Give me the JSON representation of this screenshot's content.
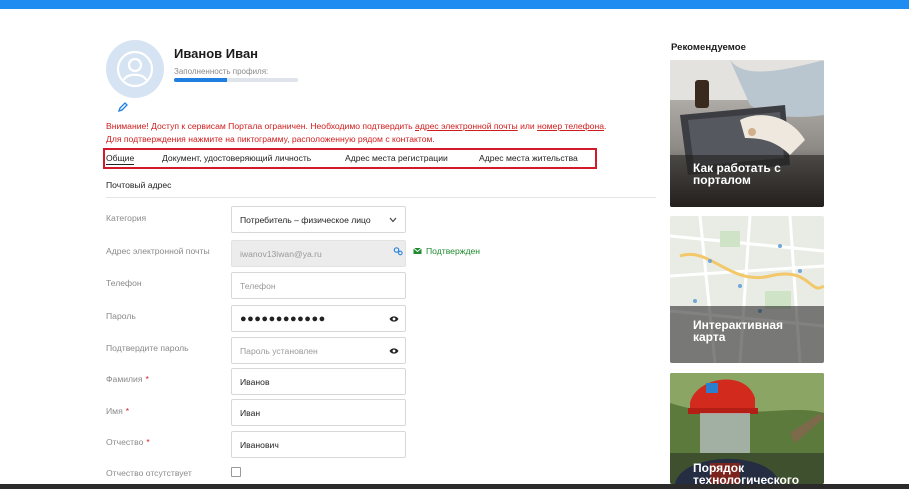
{
  "profile": {
    "name": "Иванов Иван",
    "completeness_label": "Заполненность профиля:",
    "completeness_fraction": 0.43
  },
  "warning": {
    "part1": "Внимание! Доступ к сервисам Портала ограничен. Необходимо подтвердить ",
    "email_link": "адрес электронной почты",
    "part2": " или ",
    "phone_link": "номер телефона",
    "part3": ".",
    "line2": "Для подтверждения нажмите на пиктограмму, расположенную рядом с контактом."
  },
  "tabs": [
    {
      "label": "Общие",
      "active": true
    },
    {
      "label": "Документ, удостоверяющий личность",
      "active": false
    },
    {
      "label": "Адрес места регистрации",
      "active": false
    },
    {
      "label": "Адрес места жительства",
      "active": false
    }
  ],
  "section_title": "Почтовый адрес",
  "form": {
    "category": {
      "label": "Категория",
      "value": "Потребитель – физическое лицо"
    },
    "email": {
      "label": "Адрес электронной почты",
      "value": "iwanov13iwan@ya.ru",
      "status": "Подтвержден"
    },
    "phone": {
      "label": "Телефон",
      "placeholder": "Телефон"
    },
    "password": {
      "label": "Пароль",
      "value": "●●●●●●●●●●●●"
    },
    "password_confirm": {
      "label": "Подтвердите пароль",
      "placeholder": "Пароль установлен"
    },
    "last_name": {
      "label": "Фамилия",
      "required": "*",
      "value": "Иванов"
    },
    "first_name": {
      "label": "Имя",
      "required": "*",
      "value": "Иван"
    },
    "middle_name": {
      "label": "Отчество",
      "required": "*",
      "value": "Иванович"
    },
    "no_middle_name": {
      "label": "Отчество отсутствует",
      "checked": false
    }
  },
  "sidebar": {
    "title": "Рекомендуемое",
    "cards": [
      {
        "label_line1": "Как работать с",
        "label_line2": "порталом",
        "icon": "laptop-photo"
      },
      {
        "label_line1": "Интерактивная",
        "label_line2": "карта",
        "icon": "map-photo"
      },
      {
        "label_line1": "Порядок",
        "label_line2": "технологического",
        "icon": "worker-photo"
      }
    ]
  },
  "colors": {
    "accent": "#1e8cf0",
    "warning": "#d11c1c",
    "success": "#1f8a2e",
    "tab_highlight": "#d11a2a"
  }
}
